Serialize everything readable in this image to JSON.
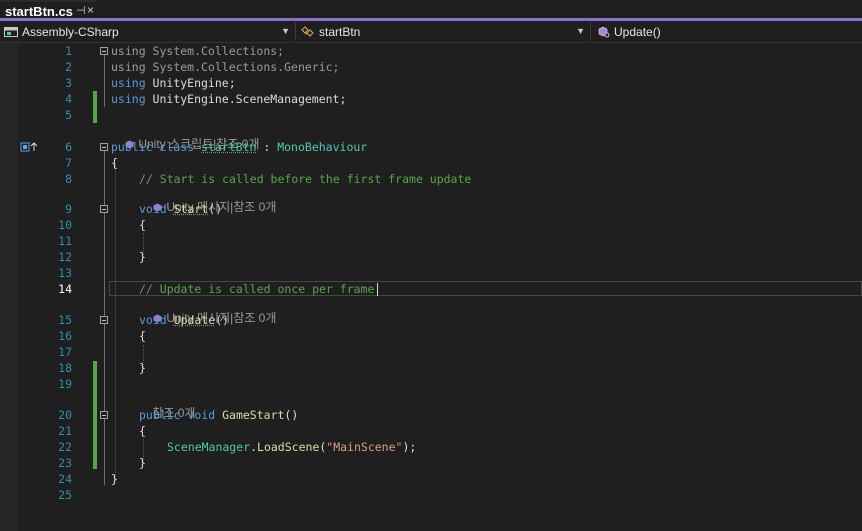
{
  "tab": {
    "title": "startBtn.cs",
    "pin_glyph": "⊣",
    "close_glyph": "×"
  },
  "navbar": {
    "project": "Assembly-CSharp",
    "class_name": "startBtn",
    "member": "Update()"
  },
  "editor": {
    "codelens": {
      "class": "Unity 스크립트|참조 0개",
      "start": "Unity 메시지|참조 0개",
      "update": "Unity 메시지|참조 0개",
      "gamestart": "참조 0개"
    },
    "line_numbers": [
      "1",
      "2",
      "3",
      "4",
      "5",
      "6",
      "7",
      "8",
      "9",
      "10",
      "11",
      "12",
      "13",
      "14",
      "15",
      "16",
      "17",
      "18",
      "19",
      "20",
      "21",
      "22",
      "23",
      "24",
      "25"
    ],
    "current_line": "14",
    "code": {
      "l1_kw": "using",
      "l1_rest": " System.Collections;",
      "l2_kw": "using",
      "l2_rest": " System.Collections.Generic;",
      "l3_kw": "using",
      "l3_rest": " UnityEngine;",
      "l4_kw": "using",
      "l4_rest": " UnityEngine.SceneManagement;",
      "l6_kw": "public class",
      "l6_name": "startBtn",
      "l6_colon": " : ",
      "l6_base": "MonoBehaviour",
      "l7": "{",
      "l8": "// Start is called before the first frame update",
      "l9_kw": "void",
      "l9_name": "Start",
      "l9_paren": "()",
      "l10": "{",
      "l12": "}",
      "l14": "// Update is called once per frame",
      "l15_kw": "void",
      "l15_name": "Update",
      "l15_paren": "()",
      "l16": "{",
      "l18": "}",
      "l20_kw": "public void",
      "l20_name": "GameStart",
      "l20_paren": "()",
      "l21": "{",
      "l22_type": "SceneManager",
      "l22_dot": ".",
      "l22_method": "LoadScene",
      "l22_open": "(",
      "l22_str": "\"MainScene\"",
      "l22_close": ");",
      "l23": "}",
      "l24": "}"
    }
  },
  "colors": {
    "keyword": "#569cd6",
    "type": "#4ec9b0",
    "method": "#dcdcaa",
    "comment": "#57a64a",
    "string": "#d69d85",
    "line_number": "#2b91af",
    "tab_accent": "#8a6fd1",
    "background": "#1f1f1f"
  }
}
